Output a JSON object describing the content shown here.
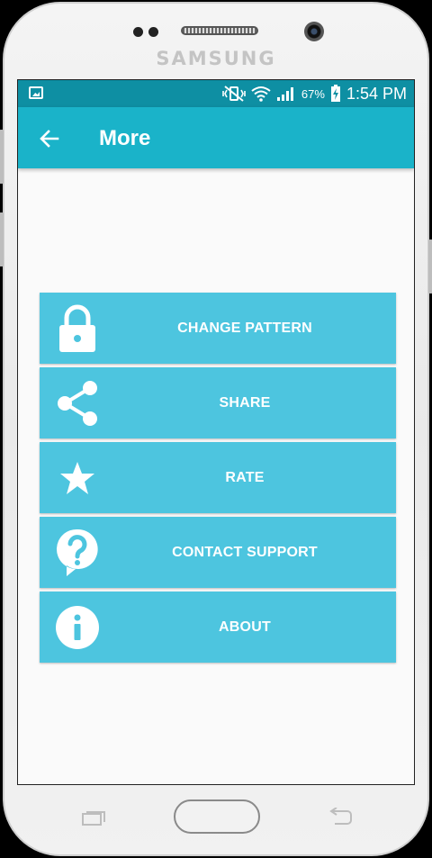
{
  "device": {
    "brand": "SAMSUNG"
  },
  "status_bar": {
    "battery_percent": "67%",
    "time": "1:54 PM"
  },
  "app_bar": {
    "title": "More"
  },
  "menu": {
    "items": [
      {
        "label": "CHANGE PATTERN",
        "icon": "lock-icon"
      },
      {
        "label": "SHARE",
        "icon": "share-icon"
      },
      {
        "label": "RATE",
        "icon": "star-icon"
      },
      {
        "label": "CONTACT SUPPORT",
        "icon": "help-bubble-icon"
      },
      {
        "label": "ABOUT",
        "icon": "info-icon"
      }
    ]
  },
  "colors": {
    "status_bar": "#0e8fa3",
    "app_bar": "#1ab3c9",
    "menu_item": "#4dc5df",
    "screen_background": "#fafafa"
  }
}
